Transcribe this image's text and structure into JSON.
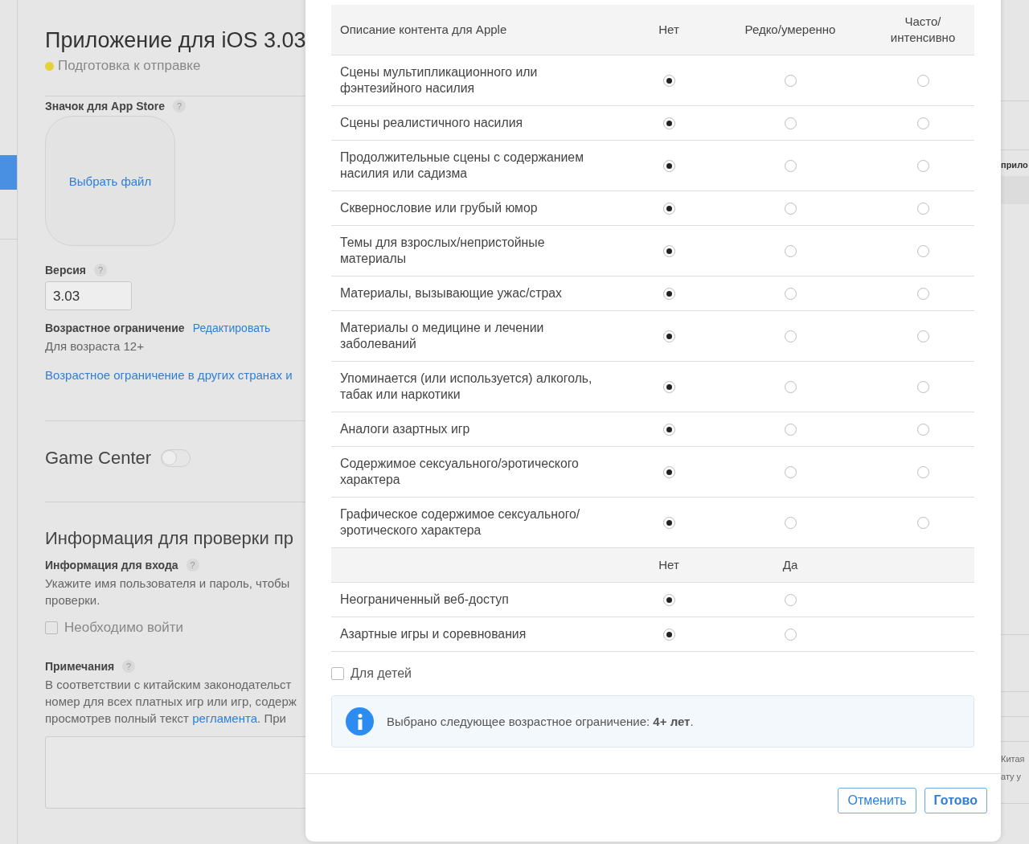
{
  "app": {
    "title": "Приложение для iOS 3.03",
    "status": "Подготовка к отправке"
  },
  "icon_section": {
    "label": "Значок для App Store",
    "help": "?",
    "action": "Выбрать файл"
  },
  "version": {
    "label": "Версия",
    "help": "?",
    "value": "3.03"
  },
  "age_rating": {
    "label": "Возрастное ограничение",
    "edit_link": "Редактировать",
    "value": "Для возраста 12+",
    "other_link": "Возрастное ограничение в других странах и"
  },
  "game_center": {
    "label": "Game Center",
    "on": false
  },
  "review_info": {
    "title": "Информация для проверки пр",
    "login": {
      "label": "Информация для входа",
      "help": "?",
      "lines": [
        "Укажите имя пользователя и пароль, чтобы",
        "проверки."
      ],
      "checkbox": {
        "label": "Необходимо войти",
        "checked": false
      }
    },
    "notes": {
      "label": "Примечания",
      "help": "?",
      "lines": [
        "В соответствии с китайским законодательст",
        "номер для всех платных игр или игр, содерж"
      ],
      "last_line": {
        "before": "просмотрев полный текст ",
        "link": "регламента",
        "after": ". При"
      }
    }
  },
  "right_edge": {
    "label": "прило",
    "lines": [
      "Китая",
      "ату у"
    ]
  },
  "dialog": {
    "table": {
      "columns": [
        "Описание контента для Apple",
        "Нет",
        "Редко/умеренно",
        "Часто/ интенсивно"
      ],
      "rows": [
        {
          "label": "Сцены мультипликационного или фэнтезийного насилия",
          "options": [
            {
              "selected": true
            },
            {
              "selected": false
            },
            {
              "selected": false
            }
          ]
        },
        {
          "label": "Сцены реалистичного насилия",
          "options": [
            {
              "selected": true
            },
            {
              "selected": false
            },
            {
              "selected": false
            }
          ]
        },
        {
          "label": "Продолжительные сцены с содержанием насилия или садизма",
          "options": [
            {
              "selected": true
            },
            {
              "selected": false
            },
            {
              "selected": false
            }
          ]
        },
        {
          "label": "Сквернословие или грубый юмор",
          "options": [
            {
              "selected": true
            },
            {
              "selected": false
            },
            {
              "selected": false
            }
          ]
        },
        {
          "label": "Темы для взрослых/непристойные материалы",
          "options": [
            {
              "selected": true
            },
            {
              "selected": false
            },
            {
              "selected": false
            }
          ]
        },
        {
          "label": "Материалы, вызывающие ужас/страх",
          "options": [
            {
              "selected": true
            },
            {
              "selected": false
            },
            {
              "selected": false
            }
          ]
        },
        {
          "label": "Материалы о медицине и лечении заболеваний",
          "options": [
            {
              "selected": true
            },
            {
              "selected": false
            },
            {
              "selected": false
            }
          ]
        },
        {
          "label": "Упоминается (или используется) алкоголь, табак или наркотики",
          "options": [
            {
              "selected": true
            },
            {
              "selected": false
            },
            {
              "selected": false
            }
          ]
        },
        {
          "label": "Аналоги азартных игр",
          "options": [
            {
              "selected": true
            },
            {
              "selected": false
            },
            {
              "selected": false
            }
          ]
        },
        {
          "label": "Содержимое сексуального/эротического характера",
          "options": [
            {
              "selected": true
            },
            {
              "selected": false
            },
            {
              "selected": false
            }
          ]
        },
        {
          "label": "Графическое содержимое сексуального/ эротического характера",
          "options": [
            {
              "selected": true
            },
            {
              "selected": false
            },
            {
              "selected": false
            }
          ]
        }
      ]
    },
    "table2": {
      "columns": [
        "Нет",
        "Да"
      ],
      "rows": [
        {
          "label": "Неограниченный веб-доступ",
          "options": [
            {
              "selected": true
            },
            {
              "selected": false
            }
          ]
        },
        {
          "label": "Азартные игры и соревнования",
          "options": [
            {
              "selected": true
            },
            {
              "selected": false
            }
          ]
        }
      ]
    },
    "kids_checkbox": {
      "label": "Для детей",
      "checked": false
    },
    "info": "Выбрано следующее возрастное ограничение: **4+ лет**.",
    "buttons": [
      {
        "label": "Отменить",
        "kind": "secondary"
      },
      {
        "label": "Готово",
        "kind": "primary"
      }
    ]
  }
}
